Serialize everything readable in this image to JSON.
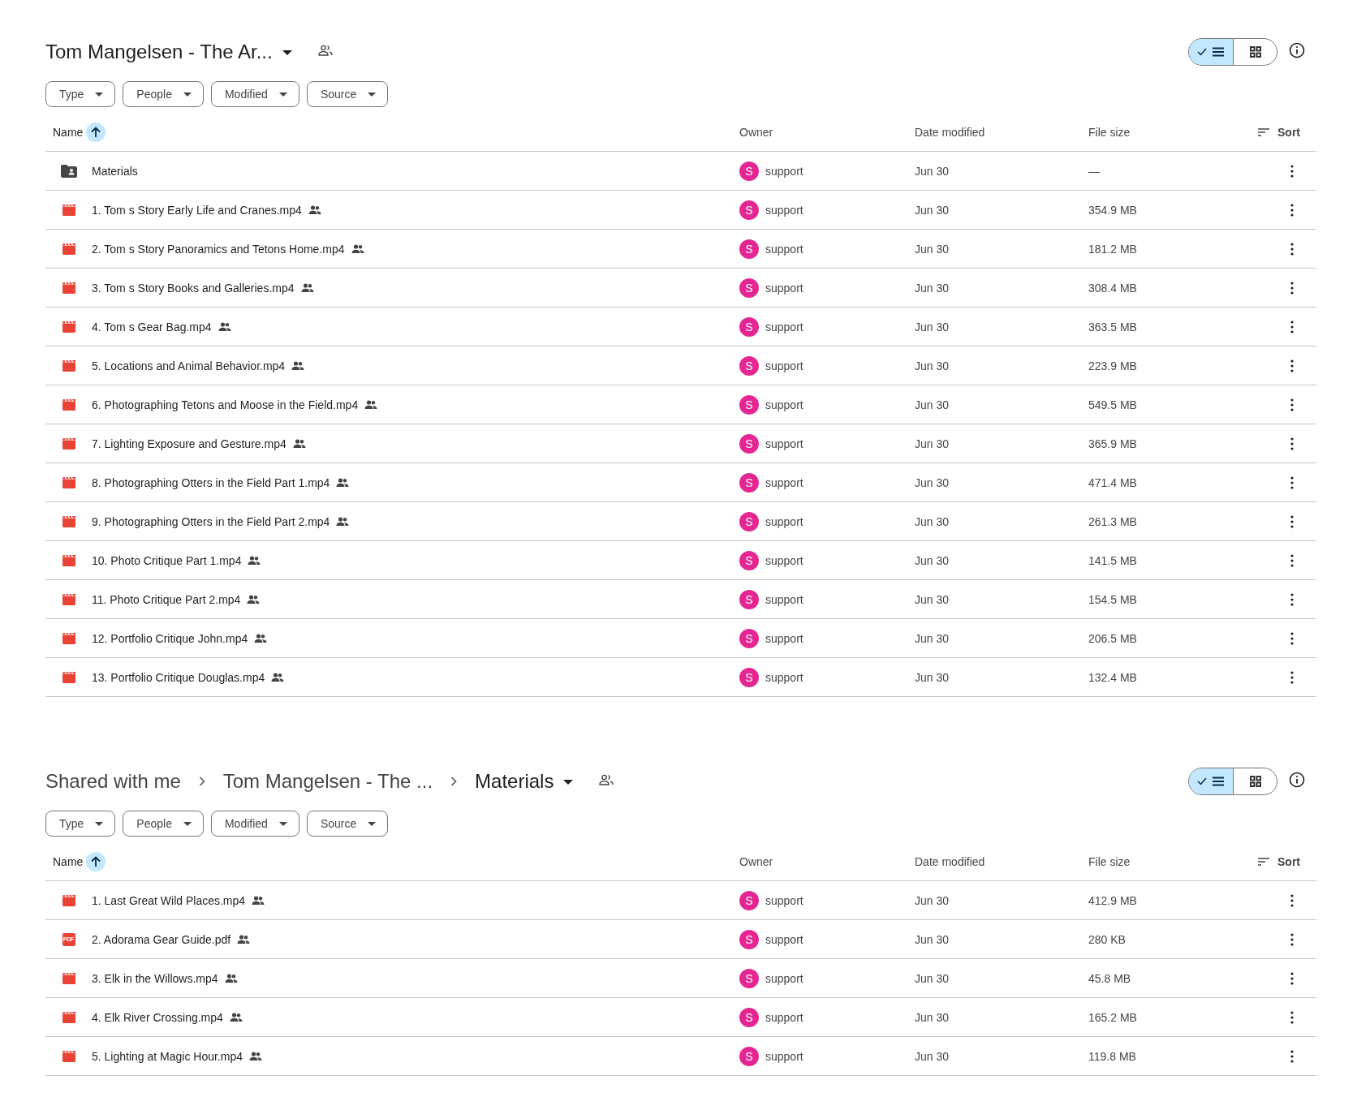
{
  "panels": [
    {
      "breadcrumbs": [
        {
          "label": "Tom Mangelsen - The Ar...",
          "current": true
        }
      ],
      "view_options": [
        {
          "kind": "list",
          "selected": true
        },
        {
          "kind": "grid",
          "selected": false
        }
      ],
      "filters": [
        "Type",
        "People",
        "Modified",
        "Source"
      ],
      "columns": {
        "name": "Name",
        "owner": "Owner",
        "date": "Date modified",
        "size": "File size",
        "sort": "Sort"
      },
      "sorted_ascending": true,
      "rows": [
        {
          "kind": "folder",
          "name": "Materials",
          "shared": false,
          "owner": "support",
          "owner_initial": "S",
          "date": "Jun 30",
          "size": "—"
        },
        {
          "kind": "video",
          "name": "1. Tom s Story Early Life and Cranes.mp4",
          "shared": true,
          "owner": "support",
          "owner_initial": "S",
          "date": "Jun 30",
          "size": "354.9 MB"
        },
        {
          "kind": "video",
          "name": "2. Tom s Story Panoramics and Tetons Home.mp4",
          "shared": true,
          "owner": "support",
          "owner_initial": "S",
          "date": "Jun 30",
          "size": "181.2 MB"
        },
        {
          "kind": "video",
          "name": "3. Tom s Story Books and Galleries.mp4",
          "shared": true,
          "owner": "support",
          "owner_initial": "S",
          "date": "Jun 30",
          "size": "308.4 MB"
        },
        {
          "kind": "video",
          "name": "4. Tom s Gear Bag.mp4",
          "shared": true,
          "owner": "support",
          "owner_initial": "S",
          "date": "Jun 30",
          "size": "363.5 MB"
        },
        {
          "kind": "video",
          "name": "5. Locations and Animal Behavior.mp4",
          "shared": true,
          "owner": "support",
          "owner_initial": "S",
          "date": "Jun 30",
          "size": "223.9 MB"
        },
        {
          "kind": "video",
          "name": "6. Photographing Tetons and Moose in the Field.mp4",
          "shared": true,
          "owner": "support",
          "owner_initial": "S",
          "date": "Jun 30",
          "size": "549.5 MB"
        },
        {
          "kind": "video",
          "name": "7. Lighting Exposure and Gesture.mp4",
          "shared": true,
          "owner": "support",
          "owner_initial": "S",
          "date": "Jun 30",
          "size": "365.9 MB"
        },
        {
          "kind": "video",
          "name": "8. Photographing Otters in the Field Part 1.mp4",
          "shared": true,
          "owner": "support",
          "owner_initial": "S",
          "date": "Jun 30",
          "size": "471.4 MB"
        },
        {
          "kind": "video",
          "name": "9. Photographing Otters in the Field Part 2.mp4",
          "shared": true,
          "owner": "support",
          "owner_initial": "S",
          "date": "Jun 30",
          "size": "261.3 MB"
        },
        {
          "kind": "video",
          "name": "10. Photo Critique Part 1.mp4",
          "shared": true,
          "owner": "support",
          "owner_initial": "S",
          "date": "Jun 30",
          "size": "141.5 MB"
        },
        {
          "kind": "video",
          "name": "11. Photo Critique Part 2.mp4",
          "shared": true,
          "owner": "support",
          "owner_initial": "S",
          "date": "Jun 30",
          "size": "154.5 MB"
        },
        {
          "kind": "video",
          "name": "12. Portfolio Critique John.mp4",
          "shared": true,
          "owner": "support",
          "owner_initial": "S",
          "date": "Jun 30",
          "size": "206.5 MB"
        },
        {
          "kind": "video",
          "name": "13. Portfolio Critique Douglas.mp4",
          "shared": true,
          "owner": "support",
          "owner_initial": "S",
          "date": "Jun 30",
          "size": "132.4 MB"
        }
      ]
    },
    {
      "breadcrumbs": [
        {
          "label": "Shared with me",
          "current": false
        },
        {
          "label": "Tom Mangelsen - The ...",
          "current": false
        },
        {
          "label": "Materials",
          "current": true
        }
      ],
      "view_options": [
        {
          "kind": "list",
          "selected": true
        },
        {
          "kind": "grid",
          "selected": false
        }
      ],
      "filters": [
        "Type",
        "People",
        "Modified",
        "Source"
      ],
      "columns": {
        "name": "Name",
        "owner": "Owner",
        "date": "Date modified",
        "size": "File size",
        "sort": "Sort"
      },
      "sorted_ascending": true,
      "rows": [
        {
          "kind": "video",
          "name": "1. Last Great Wild Places.mp4",
          "shared": true,
          "owner": "support",
          "owner_initial": "S",
          "date": "Jun 30",
          "size": "412.9 MB"
        },
        {
          "kind": "pdf",
          "icon_label": "PDF",
          "name": "2. Adorama Gear Guide.pdf",
          "shared": true,
          "owner": "support",
          "owner_initial": "S",
          "date": "Jun 30",
          "size": "280 KB"
        },
        {
          "kind": "video",
          "name": "3. Elk in the Willows.mp4",
          "shared": true,
          "owner": "support",
          "owner_initial": "S",
          "date": "Jun 30",
          "size": "45.8 MB"
        },
        {
          "kind": "video",
          "name": "4. Elk River Crossing.mp4",
          "shared": true,
          "owner": "support",
          "owner_initial": "S",
          "date": "Jun 30",
          "size": "165.2 MB"
        },
        {
          "kind": "video",
          "name": "5. Lighting at Magic Hour.mp4",
          "shared": true,
          "owner": "support",
          "owner_initial": "S",
          "date": "Jun 30",
          "size": "119.8 MB"
        }
      ]
    }
  ]
}
